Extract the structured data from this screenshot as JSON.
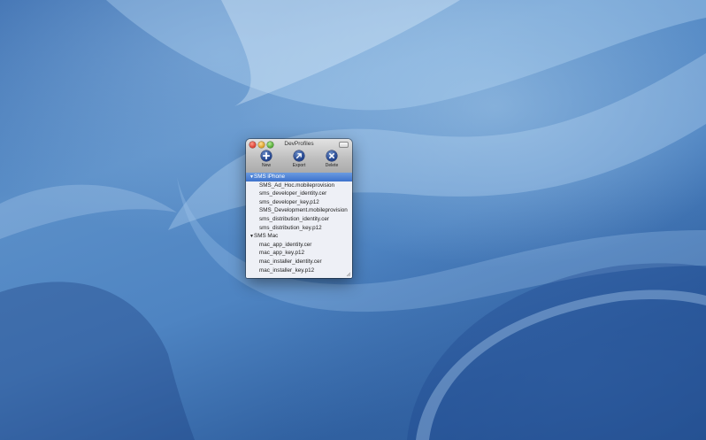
{
  "window": {
    "title": "DevProfiles"
  },
  "toolbar": {
    "new_label": "New",
    "export_label": "Export",
    "delete_label": "Delete"
  },
  "outline": {
    "groups": [
      {
        "name": "SMS iPhone",
        "expanded": true,
        "selected": true,
        "items": [
          "SMS_Ad_Hoc.mobileprovision",
          "sms_developer_identity.cer",
          "sms_developer_key.p12",
          "SMS_Development.mobileprovision",
          "sms_distribution_identity.cer",
          "sms_distribution_key.p12"
        ]
      },
      {
        "name": "SMS Mac",
        "expanded": true,
        "selected": false,
        "items": [
          "mac_app_identity.cer",
          "mac_app_key.p12",
          "mac_installer_identity.cer",
          "mac_installer_key.p12"
        ]
      }
    ]
  },
  "colors": {
    "selection": "#3d72cc",
    "desktop": "#4e84c2"
  },
  "icons": {
    "new": "plus-icon",
    "export": "arrow-up-right-icon",
    "delete": "x-icon"
  }
}
